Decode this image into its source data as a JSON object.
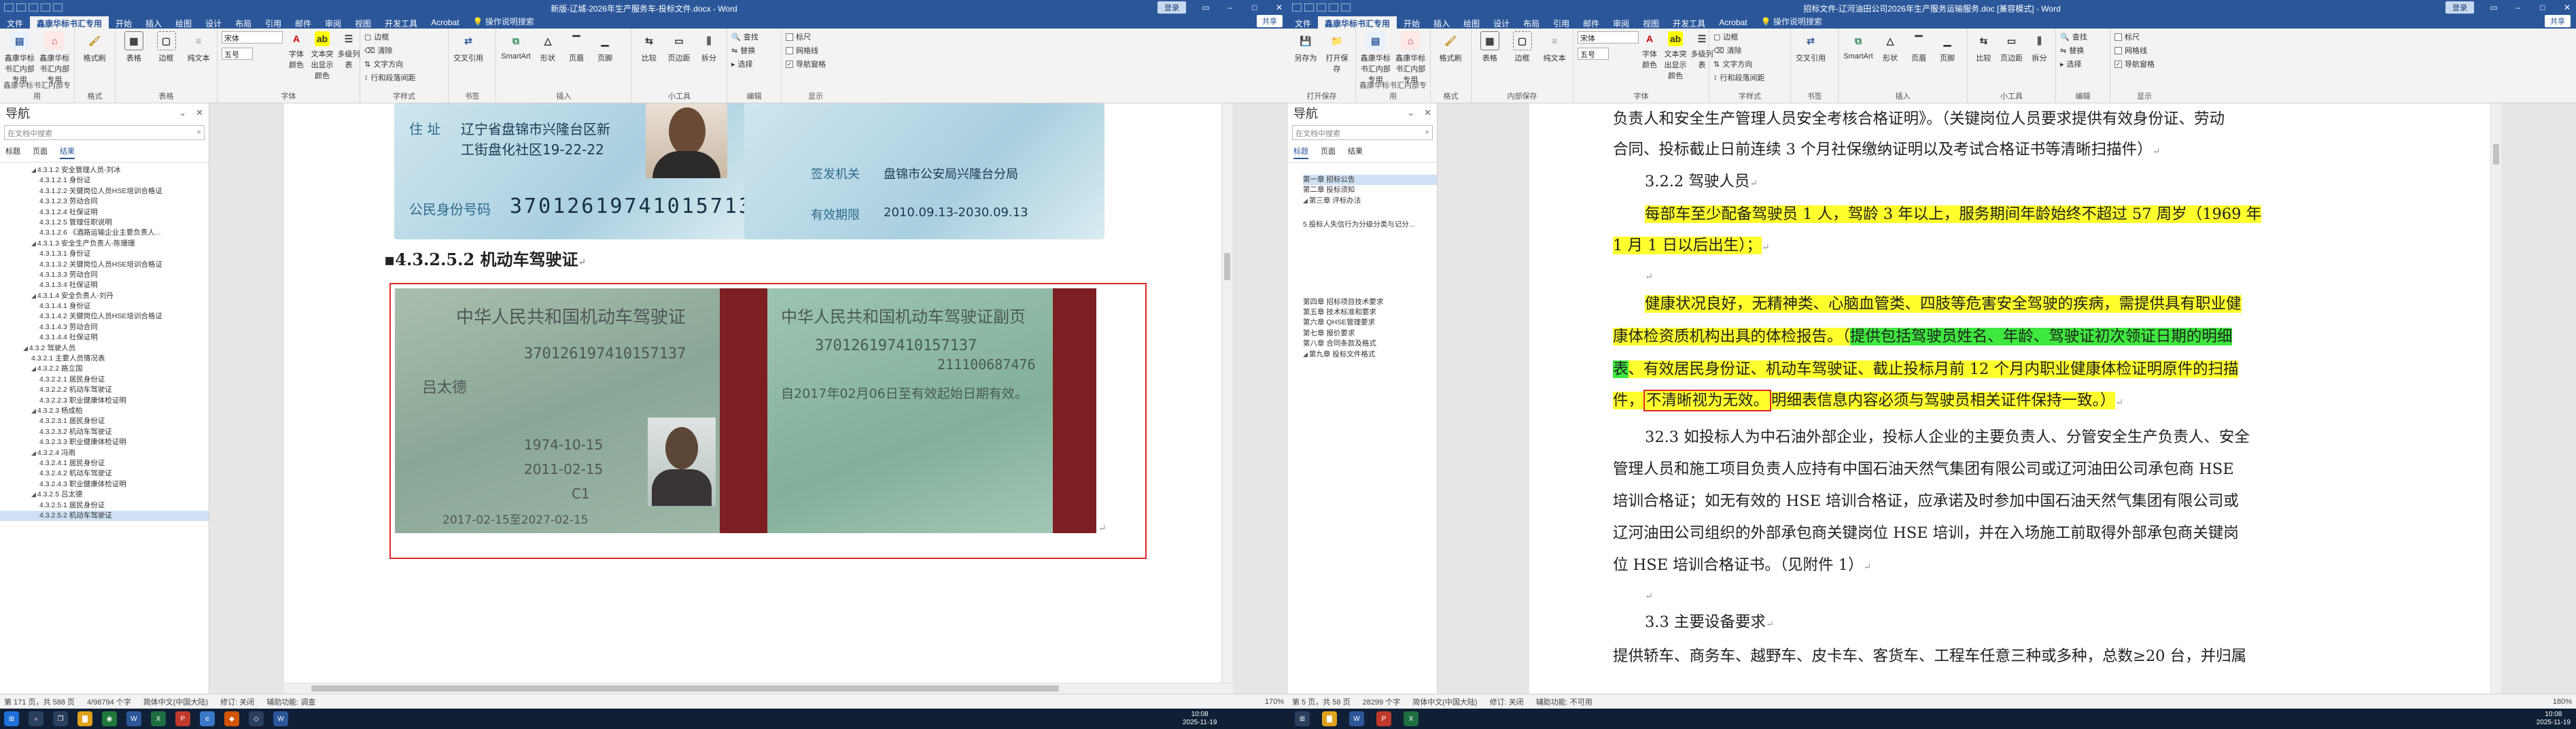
{
  "left": {
    "title": "新版-辽城-2026年生产服务车-投标文件.docx  -  Word",
    "login": "登录",
    "tabs": [
      "文件",
      "鑫康华标书汇专用",
      "开始",
      "插入",
      "绘图",
      "设计",
      "布局",
      "引用",
      "邮件",
      "审阅",
      "视图",
      "开发工具",
      "Acrobat"
    ],
    "tellme": "操作说明搜索",
    "share": "共享",
    "ribbon": {
      "g1": {
        "btn1": "鑫康华标书汇内部专用",
        "btn2": "鑫康华标书汇内部专用",
        "label": "鑫康华标书汇内部专用"
      },
      "g2": {
        "btn1": "格式刷",
        "label": "格式"
      },
      "g3": {
        "btn1": "表格",
        "btn2": "边框",
        "btn3": "纯文本",
        "label": "表格"
      },
      "g4": {
        "font": "宋体",
        "size": "五号",
        "btn1": "字体颜色",
        "btn2": "文本突出显示颜色",
        "btn3": "多级列表",
        "label": "字体"
      },
      "g5": {
        "s1": "边框",
        "s2": "清除",
        "s3": "文字方向",
        "s4": "行和段落间距",
        "label": "字样式"
      },
      "g6": {
        "btn1": "交叉引用",
        "label": "书签"
      },
      "g7": {
        "btn1": "SmartArt",
        "btn2": "形状",
        "btn3": "页眉",
        "btn4": "页脚",
        "label": "插入"
      },
      "g8": {
        "btn1": "比较",
        "btn2": "页边距",
        "btn3": "拆分",
        "label": "小工具"
      },
      "g9": {
        "s1": "查找",
        "s2": "替换",
        "s3": "选择",
        "label": "编辑"
      },
      "g10": {
        "s1": "标尺",
        "s2": "网格线",
        "s3": "导航窗格",
        "label": "显示"
      }
    },
    "nav": {
      "title": "导航",
      "search_placeholder": "在文档中搜索",
      "tabs": [
        "标题",
        "页面",
        "结果"
      ],
      "items": [
        "4.3.1.2 安全管理人员-刘冰",
        "4.3.1.2.1 身份证",
        "4.3.1.2.2 关键岗位人员HSE培训合格证",
        "4.3.1.2.3 劳动合同",
        "4.3.1.2.4 社保证明",
        "4.3.1.2.5 管理任职说明",
        "4.3.1.2.6 《酒路运输企业主要负责人...",
        "4.3.1.3 安全生产负责人-陈珊珊",
        "4.3.1.3.1 身份证",
        "4.3.1.3.2 关键岗位人员HSE培训合格证",
        "4.3.1.3.3 劳动合同",
        "4.3.1.3.4 社保证明",
        "4.3.1.4 安全负责人-刘丹",
        "4.3.1.4.1 身份证",
        "4.3.1.4.2 关键岗位人员HSE培训合格证",
        "4.3.1.4.3 劳动合同",
        "4.3.1.4.4 社保证明",
        "4.3.2 驾驶人员",
        "4.3.2.1 主要人员情况表",
        "4.3.2.2 路立国",
        "4.3.2.2.1 居民身份证",
        "4.3.2.2.2 机动车驾驶证",
        "4.3.2.2.3 职业健康体检证明",
        "4.3.2.3 杨成柏",
        "4.3.2.3.1 居民身份证",
        "4.3.2.3.2 机动车驾驶证",
        "4.3.2.3.3 职业健康体检证明",
        "4.3.2.4 冯雨",
        "4.3.2.4.1 居民身份证",
        "4.3.2.4.2 机动车驾驶证",
        "4.3.2.4.3 职业健康体检证明",
        "4.3.2.5 吕太德",
        "4.3.2.5.1 居民身份证",
        "4.3.2.5.2 机动车驾驶证"
      ],
      "current_index": 33
    },
    "doc": {
      "id_lbl1": "住  址",
      "id_addr1": "辽宁省盘锦市兴隆台区新",
      "id_addr2": "工街盘化社区19-22-22",
      "id_lbl2": "公民身份号码",
      "id_number": "370126197410157137",
      "id_issuer_lbl": "签发机关",
      "id_issuer": "盘锦市公安局兴隆台分局",
      "id_valid_lbl": "有效期限",
      "id_valid": "2010.09.13-2030.09.13",
      "heading": "4.3.2.5.2 机动车驾驶证",
      "lic_title_left": "中华人民共和国机动车驾驶证",
      "lic_title_right": "中华人民共和国机动车驾驶证副页",
      "lic_num_left": "370126197410157137",
      "lic_num_right": "370126197410157137",
      "lic_file": "211100687476",
      "lic_name": "吕太德",
      "lic_note": "自2017年02月06日至有效起始日期有效。",
      "lic_date1": "1974-10-15",
      "lic_date2": "2011-02-15",
      "lic_class": "C1",
      "lic_valid": "2017-02-15至2027-02-15"
    },
    "status": {
      "page": "第 171 页，共 588 页",
      "words": "4/98794 个字",
      "lang": "简体中文(中国大陆)",
      "track": "修订: 关闭",
      "access": "辅助功能: 调查",
      "zoom": "170%"
    }
  },
  "right": {
    "title": "招标文件-辽河油田公司2026年生产服务运输服务.doc [兼容模式]  -  Word",
    "login": "登录",
    "tabs": [
      "文件",
      "鑫康华标书汇专用",
      "开始",
      "插入",
      "绘图",
      "设计",
      "布局",
      "引用",
      "邮件",
      "审阅",
      "视图",
      "开发工具",
      "Acrobat"
    ],
    "tellme": "操作说明搜索",
    "share": "共享",
    "ribbon": {
      "g0": {
        "btn1": "另存为",
        "btn2": "打开保存",
        "label": "打开保存"
      },
      "g1": {
        "btn1": "鑫康华标书汇内部专用",
        "btn2": "鑫康华标书汇内部专用",
        "label": "鑫康华标书汇内部专用"
      },
      "g2": {
        "btn1": "格式刷",
        "label": "格式"
      },
      "g3": {
        "btn1": "表格",
        "btn2": "边框",
        "btn3": "纯文本",
        "label": "内部保存"
      },
      "g4": {
        "font": "宋体",
        "size": "五号",
        "btn1": "字体颜色",
        "btn2": "文本突出显示颜色",
        "btn3": "多级列表",
        "label": "字体"
      },
      "g5": {
        "s1": "边框",
        "s2": "清除",
        "s3": "文字方向",
        "s4": "行和段落间距",
        "label": "字样式"
      },
      "g6": {
        "btn1": "交叉引用",
        "label": "书签"
      },
      "g7": {
        "btn1": "SmartArt",
        "btn2": "形状",
        "btn3": "页眉",
        "btn4": "页脚",
        "label": "插入"
      },
      "g8": {
        "btn1": "比较",
        "btn2": "页边距",
        "btn3": "拆分",
        "label": "小工具"
      },
      "g9": {
        "s1": "查找",
        "s2": "替换",
        "s3": "选择",
        "label": "编辑"
      },
      "g10": {
        "s1": "标尺",
        "s2": "网格线",
        "s3": "导航窗格",
        "label": "显示"
      }
    },
    "nav": {
      "title": "导航",
      "search_placeholder": "在文档中搜索",
      "tabs": [
        "标题",
        "页面",
        "结果"
      ],
      "items_top": [
        "第一章 招标公告",
        "第二章 投标须知",
        "第三章 评标办法"
      ],
      "item_mid": "5.投标人失信行为分级分类与记分...",
      "items_bottom": [
        "第四章 招标项目技术要求",
        "第五章 技术标准和要求",
        "第六章 QHSE管理要求",
        "第七章 报价要求",
        "第八章 合同条款及格式",
        "第九章 投标文件格式"
      ]
    },
    "doc": {
      "p1a": "负责人和安全生产管理人员安全考核合格证明》。（关键岗位人员要求提供有效身份证、劳动",
      "p1b": "合同、投标截止日前连续 3 个月社保缴纳证明以及考试合格证书等清晰扫描件）",
      "h322": "3.2.2 驾驶人员",
      "p2a": "每部车至少配备驾驶员 1 人，驾龄 3 年以上，服务期间年龄始终不超过 57 周岁（1969 年",
      "p2b": "1 月 1 日以后出生）；",
      "p3a": "健康状况良好，无精神类、心脑血管类、四肢等危害安全驾驶的疾病，需提供具有职业健",
      "p3b1": "康体检资质机构出具的体检报告。（",
      "p3b2": "提供包括驾驶员姓名、年龄、驾驶证初次领证日期的明细",
      "p3c1": "表",
      "p3c2": "、有效居民身份证、机动车驾驶证、截止投标月前 12 个月内职业健康体检证明原件的扫描",
      "p3d1": "件，",
      "p3d2": "不清晰视为无效。",
      "p3d3": "明细表信息内容必须与驾驶员相关证件保持一致。）",
      "p4a": "32.3 如投标人为中石油外部企业，投标人企业的主要负责人、分管安全生产负责人、安全",
      "p4b": "管理人员和施工项目负责人应持有中国石油天然气集团有限公司或辽河油田公司承包商 HSE",
      "p4c": "培训合格证；如无有效的 HSE 培训合格证，应承诺及时参加中国石油天然气集团有限公司或",
      "p4d": "辽河油田公司组织的外部承包商关键岗位 HSE 培训，并在入场施工前取得外部承包商关键岗",
      "p4e": "位 HSE 培训合格证书。（见附件 1）",
      "h33": "3.3 主要设备要求",
      "p5": "提供轿车、商务车、越野车、皮卡车、客货车、工程车任意三种或多种，总数≥20 台，并归属"
    },
    "status": {
      "page": "第 5 页，共 58 页",
      "words": "28299 个字",
      "lang": "简体中文(中国大陆)",
      "track": "修订: 关闭",
      "access": "辅助功能: 不可用",
      "zoom": "180%"
    }
  },
  "taskbar": {
    "clock_time": "10:08",
    "clock_date": "2025-11-19",
    "clock_time_r": "10:08",
    "clock_date_r": "2025-11-19"
  },
  "colors": {
    "word_blue": "#2b579a",
    "highlight_yellow": "#ffff2e",
    "highlight_green": "#3ee83e",
    "annotation_red": "#e0282c"
  }
}
